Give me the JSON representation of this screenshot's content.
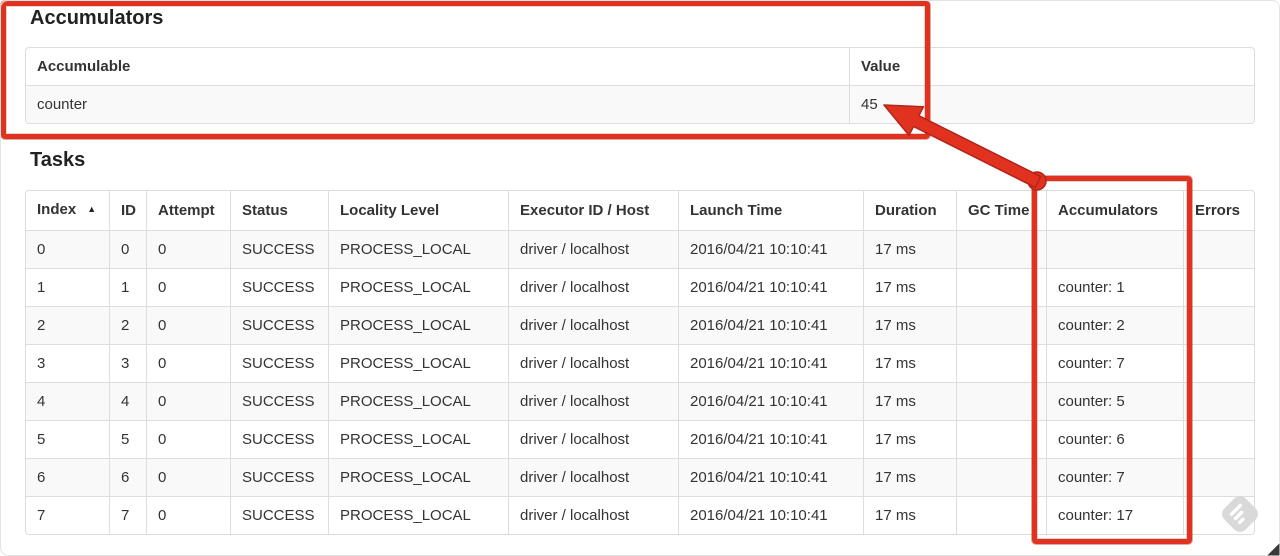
{
  "theme": {
    "annotation_red": "#e0321f",
    "table_border": "#dddddd",
    "row_stripe": "#f9f9f9",
    "text": "#333333",
    "watermark_grey": "#d9d9d9"
  },
  "accumulators_section": {
    "title": "Accumulators",
    "table": {
      "headers": [
        "Accumulable",
        "Value"
      ],
      "rows": [
        [
          "counter",
          "45"
        ]
      ]
    }
  },
  "tasks_section": {
    "title": "Tasks",
    "sort_indicator": "▲",
    "sorted_column": "Index",
    "table": {
      "headers": [
        "Index",
        "ID",
        "Attempt",
        "Status",
        "Locality Level",
        "Executor ID / Host",
        "Launch Time",
        "Duration",
        "GC Time",
        "Accumulators",
        "Errors"
      ],
      "rows": [
        [
          "0",
          "0",
          "0",
          "SUCCESS",
          "PROCESS_LOCAL",
          "driver / localhost",
          "2016/04/21 10:10:41",
          "17 ms",
          "",
          "",
          ""
        ],
        [
          "1",
          "1",
          "0",
          "SUCCESS",
          "PROCESS_LOCAL",
          "driver / localhost",
          "2016/04/21 10:10:41",
          "17 ms",
          "",
          "counter: 1",
          ""
        ],
        [
          "2",
          "2",
          "0",
          "SUCCESS",
          "PROCESS_LOCAL",
          "driver / localhost",
          "2016/04/21 10:10:41",
          "17 ms",
          "",
          "counter: 2",
          ""
        ],
        [
          "3",
          "3",
          "0",
          "SUCCESS",
          "PROCESS_LOCAL",
          "driver / localhost",
          "2016/04/21 10:10:41",
          "17 ms",
          "",
          "counter: 7",
          ""
        ],
        [
          "4",
          "4",
          "0",
          "SUCCESS",
          "PROCESS_LOCAL",
          "driver / localhost",
          "2016/04/21 10:10:41",
          "17 ms",
          "",
          "counter: 5",
          ""
        ],
        [
          "5",
          "5",
          "0",
          "SUCCESS",
          "PROCESS_LOCAL",
          "driver / localhost",
          "2016/04/21 10:10:41",
          "17 ms",
          "",
          "counter: 6",
          ""
        ],
        [
          "6",
          "6",
          "0",
          "SUCCESS",
          "PROCESS_LOCAL",
          "driver / localhost",
          "2016/04/21 10:10:41",
          "17 ms",
          "",
          "counter: 7",
          ""
        ],
        [
          "7",
          "7",
          "0",
          "SUCCESS",
          "PROCESS_LOCAL",
          "driver / localhost",
          "2016/04/21 10:10:41",
          "17 ms",
          "",
          "counter: 17",
          ""
        ]
      ]
    }
  }
}
